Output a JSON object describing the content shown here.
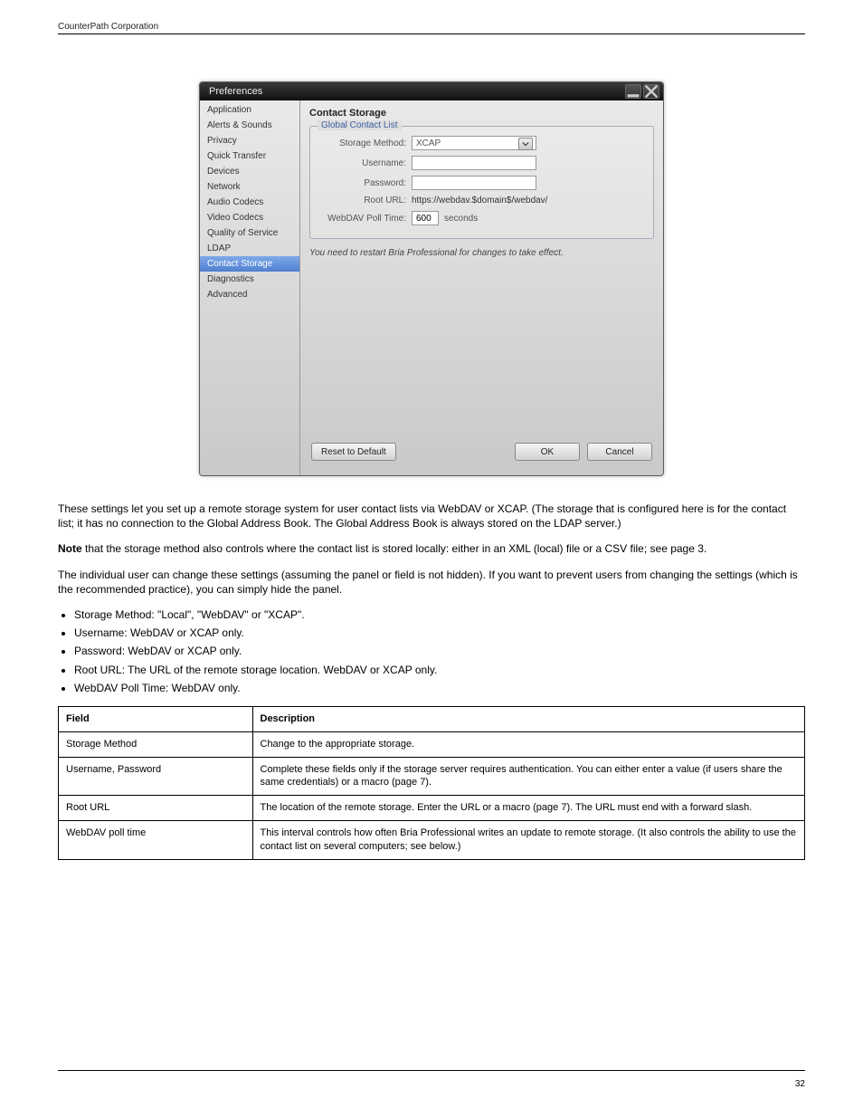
{
  "header": {
    "left": "CounterPath Corporation",
    "right": ""
  },
  "dialog": {
    "title": "Preferences",
    "sidebar": {
      "items": [
        {
          "label": "Application"
        },
        {
          "label": "Alerts & Sounds"
        },
        {
          "label": "Privacy"
        },
        {
          "label": "Quick Transfer"
        },
        {
          "label": "Devices"
        },
        {
          "label": "Network"
        },
        {
          "label": "Audio Codecs"
        },
        {
          "label": "Video Codecs"
        },
        {
          "label": "Quality of Service"
        },
        {
          "label": "LDAP"
        },
        {
          "label": "Contact Storage",
          "selected": true
        },
        {
          "label": "Diagnostics"
        },
        {
          "label": "Advanced"
        }
      ]
    },
    "content": {
      "title": "Contact Storage",
      "group_legend": "Global Contact List",
      "rows": {
        "storage_method": {
          "label": "Storage Method:",
          "value": "XCAP"
        },
        "username": {
          "label": "Username:",
          "value": ""
        },
        "password": {
          "label": "Password:",
          "value": ""
        },
        "root_url": {
          "label": "Root URL:",
          "value": "https://webdav.$domain$/webdav/"
        },
        "poll_time": {
          "label": "WebDAV Poll Time:",
          "value": "600",
          "unit": "seconds"
        }
      },
      "restart_note": "You need to restart Bria Professional for changes to take effect."
    },
    "buttons": {
      "reset": "Reset to Default",
      "ok": "OK",
      "cancel": "Cancel"
    }
  },
  "body": {
    "intro": "These settings let you set up a remote storage system for user contact lists via WebDAV or XCAP. (The storage that is configured here is for the contact list; it has no connection to the Global Address Book. The Global Address Book is always stored on the LDAP server.)",
    "note_label": "Note",
    "note_text": " that the storage method also controls where the contact list is stored locally: either in an XML (local) file or a CSV file; see page 3.",
    "intro2": "The individual user can change these settings (assuming the panel or field is not hidden). If you want to prevent users from changing the settings (which is the recommended practice), you can simply hide the panel.",
    "list": [
      "Storage Method: \"Local\", \"WebDAV\" or \"XCAP\".",
      "Username: WebDAV or XCAP only.",
      "Password: WebDAV or XCAP only.",
      "Root URL: The URL of the remote storage location. WebDAV or XCAP only.",
      "WebDAV Poll Time: WebDAV only."
    ]
  },
  "table": {
    "headers": [
      "Field",
      "Description"
    ],
    "rows": [
      {
        "f": "Storage Method",
        "d": "Change to the appropriate storage."
      },
      {
        "f": "Username, Password",
        "d": "Complete these fields only if the storage server requires authentication. You can either enter a value (if users share the same credentials) or a macro (page 7)."
      },
      {
        "f": "Root URL",
        "d": "The location of the remote storage. Enter the URL or a macro (page 7). The URL must end with a forward slash."
      },
      {
        "f": "WebDAV poll time",
        "d": "This interval controls how often Bria Professional writes an update to remote storage. (It also controls the ability to use the contact list on several computers; see below.)"
      }
    ]
  },
  "footer": {
    "page": "32"
  }
}
